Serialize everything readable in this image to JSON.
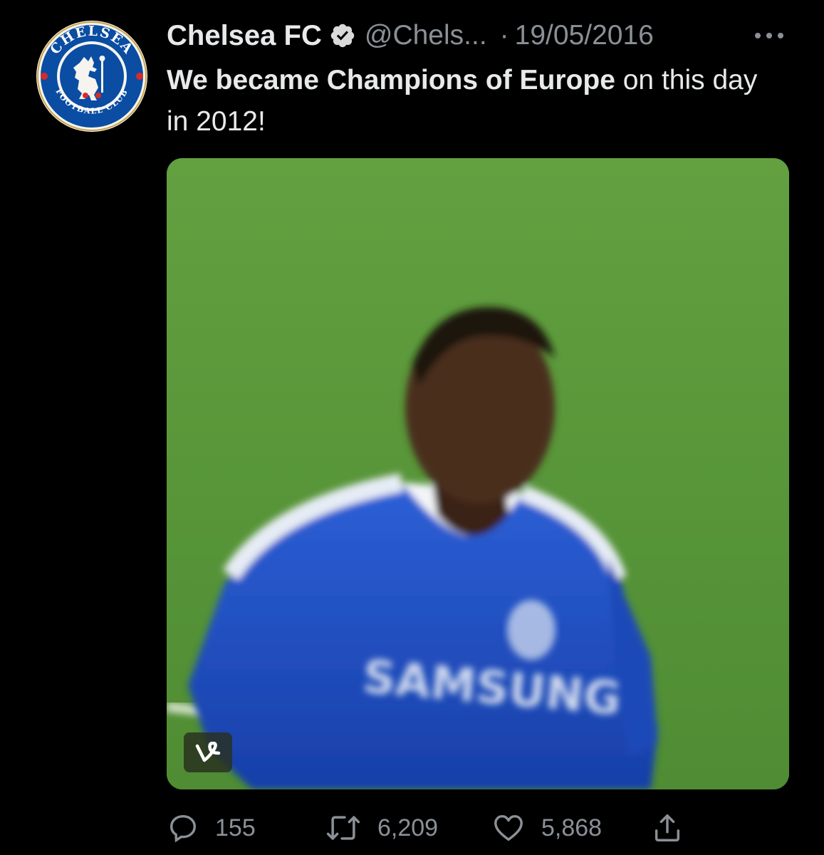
{
  "tweet": {
    "author_name": "Chelsea FC",
    "handle": "@Chels...",
    "separator": "·",
    "date": "19/05/2016",
    "text_bold": "We became Champions of Europe",
    "text_rest": " on this day in 2012!",
    "avatar_text_top": "CHELSEA",
    "avatar_text_bottom": "FOOTBALL CLUB",
    "media": {
      "shirt_sponsor": "SAMSUNG",
      "badge_icon": "vine-logo-icon"
    },
    "actions": {
      "replies": "155",
      "retweets": "6,209",
      "likes": "5,868"
    }
  },
  "icons": [
    "verified-badge-icon",
    "more-options-icon",
    "reply-icon",
    "retweet-icon",
    "like-icon",
    "share-icon",
    "vine-logo-icon"
  ],
  "colors": {
    "background": "#000000",
    "text_primary": "#e7e9ea",
    "text_secondary": "#8b9096",
    "chelsea_blue": "#034694",
    "pitch_green": "#5b9a3c"
  }
}
